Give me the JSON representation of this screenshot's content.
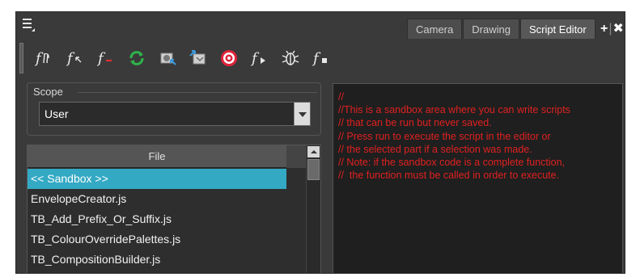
{
  "tabs": [
    {
      "label": "Camera",
      "active": false
    },
    {
      "label": "Drawing",
      "active": false
    },
    {
      "label": "Script Editor",
      "active": true
    }
  ],
  "tab_controls": {
    "add": "+",
    "separator": "|",
    "close": "✖"
  },
  "toolbar": {
    "buttons": [
      {
        "icon": "new-function-icon"
      },
      {
        "icon": "import-function-icon"
      },
      {
        "icon": "delete-function-icon"
      },
      {
        "icon": "refresh-icon"
      },
      {
        "icon": "import-script-icon"
      },
      {
        "icon": "export-script-icon"
      },
      {
        "icon": "run-target-icon"
      },
      {
        "icon": "run-function-icon"
      },
      {
        "icon": "debug-bug-icon"
      },
      {
        "icon": "stop-function-icon"
      }
    ]
  },
  "scope": {
    "label": "Scope",
    "value": "User"
  },
  "file_list": {
    "header": "File",
    "items": [
      {
        "label": "<< Sandbox >>",
        "selected": true
      },
      {
        "label": "EnvelopeCreator.js",
        "selected": false
      },
      {
        "label": "TB_Add_Prefix_Or_Suffix.js",
        "selected": false
      },
      {
        "label": "TB_ColourOverridePalettes.js",
        "selected": false
      },
      {
        "label": "TB_CompositionBuilder.js",
        "selected": false
      }
    ]
  },
  "editor": {
    "lines": [
      "//",
      "//This is a sandbox area where you can write scripts",
      "// that can be run but never saved.",
      "// Press run to execute the script in the editor or",
      "// the selected part if a selection was made.",
      "// Note: if the sandbox code is a complete function,",
      "//  the function must be called in order to execute."
    ]
  },
  "colors": {
    "panel_bg": "#3a3a3a",
    "selection": "#33a9c4",
    "code_comment": "#e02020",
    "editor_bg": "#1f1f1f"
  }
}
